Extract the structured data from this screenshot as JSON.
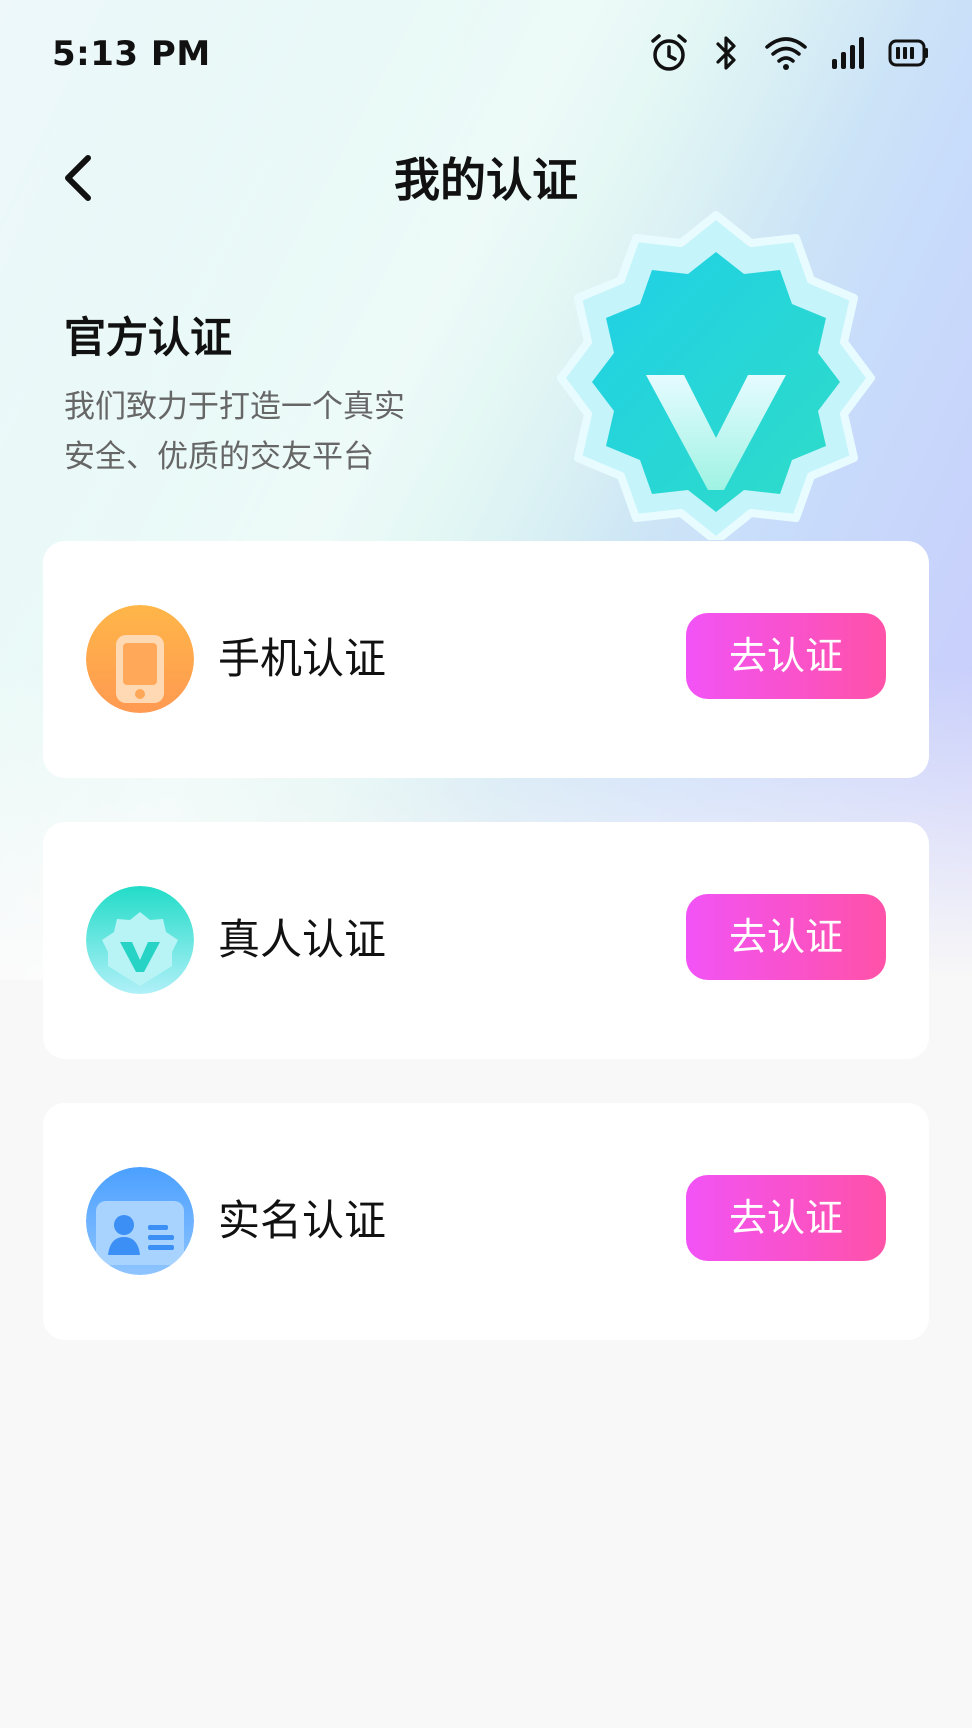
{
  "status_bar": {
    "time": "5:13 PM",
    "icons": [
      "alarm-icon",
      "bluetooth-icon",
      "wifi-icon",
      "signal-icon",
      "battery-icon"
    ]
  },
  "header": {
    "title": "我的认证",
    "back_icon": "chevron-left-icon"
  },
  "hero": {
    "title": "官方认证",
    "description_line1": "我们致力于打造一个真实",
    "description_line2": "安全、优质的交友平台",
    "badge_icon": "verified-badge-icon"
  },
  "cards": [
    {
      "label": "手机认证",
      "icon": "phone-icon",
      "button_label": "去认证"
    },
    {
      "label": "真人认证",
      "icon": "verified-badge-icon",
      "button_label": "去认证"
    },
    {
      "label": "实名认证",
      "icon": "id-card-icon",
      "button_label": "去认证"
    }
  ],
  "colors": {
    "button_gradient_start": "#f253f6",
    "button_gradient_end": "#ff52a8",
    "phone_icon": "#ffa94a",
    "person_icon": "#2fdcc8",
    "idcard_icon": "#5aa5ff"
  }
}
